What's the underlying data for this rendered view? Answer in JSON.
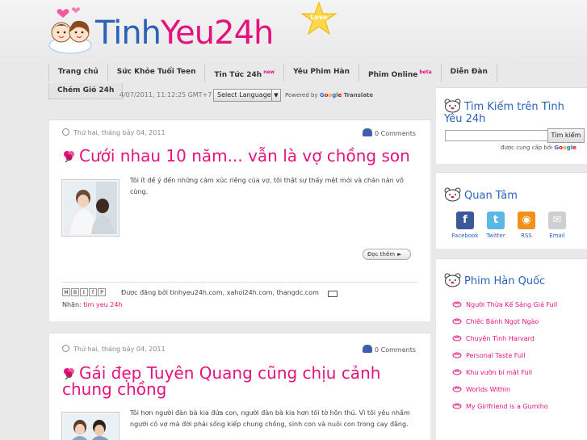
{
  "header": {
    "logo_text_a": "Tinh",
    "logo_text_b": "Yeu24h",
    "logo_badge": "Love"
  },
  "nav": {
    "items": [
      {
        "label": "Trang chủ",
        "badge": ""
      },
      {
        "label": "Sức Khỏe Tuổi Teen",
        "badge": ""
      },
      {
        "label": "Tin Tức 24h",
        "badge": "new"
      },
      {
        "label": "Yêu Phim Hàn",
        "badge": ""
      },
      {
        "label": "Phim Online",
        "badge": "beta"
      },
      {
        "label": "Diễn Đàn",
        "badge": ""
      }
    ],
    "second_row": "Chém Gió 24h"
  },
  "topbar": {
    "datetime": "4/07/2011, 11:12:25 GMT+7",
    "language_select": "Select Language",
    "powered_by": "Powered by",
    "translate": "Translate"
  },
  "posts": [
    {
      "date": "Thứ hai, tháng bảy 04, 2011",
      "comments": "0 Comments",
      "title": "Cưới nhau 10 năm... vẫn là vợ chồng son",
      "body": "Tôi ít để ý đến những cảm xúc riêng của vợ, tôi thật sự thấy mệt mỏi và chán nản vô cùng.",
      "read_more": "Đọc thêm",
      "posted_by": "Được đăng bởi tinhyeu24h.com, xahoi24h.com, thangdc.com",
      "labels_prefix": "Nhãn:",
      "label": "tim yeu 24h"
    },
    {
      "date": "Thứ hai, tháng bảy 04, 2011",
      "comments": "0 Comments",
      "title": "Gái đẹp Tuyên Quang cũng chịu cảnh chung chồng",
      "body": "Tôi hơn người đàn bà kia đứa con, người đàn bà kia hơn tôi tờ hôn thú. Vì tôi yêu nhầm người có vợ mà đời phải sống kiếp chung chồng, sinh con và nuôi con trong cay đắng."
    }
  ],
  "share_icons": [
    "M",
    "B",
    "t",
    "f",
    "P"
  ],
  "sidebar": {
    "search": {
      "title": "Tìm Kiếm trên Tình Yêu 24h",
      "button": "Tìm kiếm",
      "provided_by": "được cung cấp bởi"
    },
    "follow": {
      "title": "Quan Tâm",
      "items": [
        {
          "label": "Facebook",
          "color": "#3b5998",
          "glyph": "f"
        },
        {
          "label": "Twitter",
          "color": "#5bb8e6",
          "glyph": "t"
        },
        {
          "label": "RSS",
          "color": "#f39019",
          "glyph": "◉"
        },
        {
          "label": "Email",
          "color": "#cfcfcf",
          "glyph": "✉"
        }
      ]
    },
    "dramas": {
      "title": "Phim Hàn Quốc",
      "items": [
        "Người Thừa Kế Sáng Giá Full",
        "Chiếc Bánh Ngọt Ngào",
        "Chuyện Tình Harvard",
        "Personal Taste Full",
        "Khu vườn bí mật Full",
        "Worlds Within",
        "My Girlfriend is a Gumiho"
      ]
    }
  },
  "colors": {
    "pink": "#e5127d",
    "blue": "#2a62b8"
  }
}
